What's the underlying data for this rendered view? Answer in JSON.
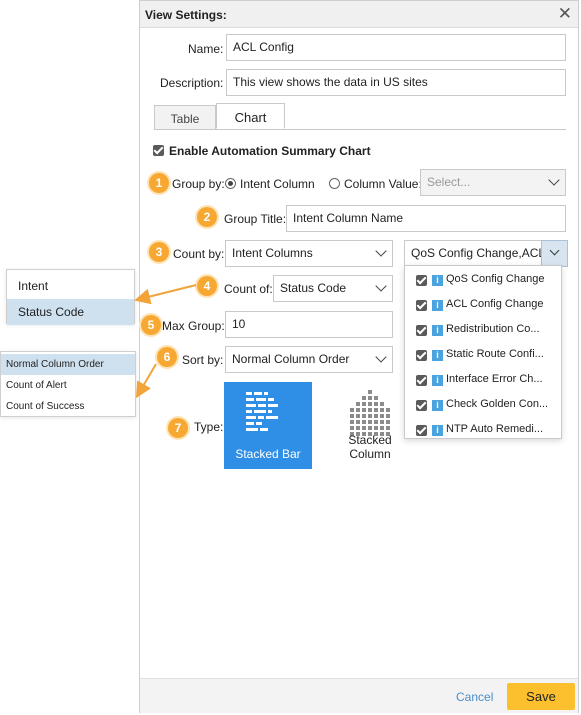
{
  "dialog": {
    "title": "View Settings:",
    "close_glyph": "✕"
  },
  "form": {
    "name_label": "Name:",
    "name_value": "ACL Config",
    "description_label": "Description:",
    "description_value": "This view shows the data in US sites"
  },
  "tabs": [
    {
      "label": "Table",
      "active": false
    },
    {
      "label": "Chart",
      "active": true
    }
  ],
  "chart_settings": {
    "enable_label": "Enable Automation Summary Chart",
    "group_by_label": "Group by:",
    "group_by_options": [
      "Intent Column",
      "Column Value:"
    ],
    "column_value_placeholder": "Select...",
    "group_title_label": "Group Title:",
    "group_title_value": "Intent Column Name",
    "count_by_label": "Count by:",
    "count_by_value": "Intent Columns",
    "count_by_multi_value": "QoS Config Change,ACL...",
    "count_of_label": "Count of:",
    "count_of_value": "Status Code",
    "max_group_label": "Max Group:",
    "max_group_value": "10",
    "sort_by_label": "Sort by:",
    "sort_by_value": "Normal Column Order",
    "type_label": "Type:",
    "types": [
      "Stacked Bar",
      "Stacked Column"
    ]
  },
  "count_by_items": [
    "QoS Config Change",
    "ACL Config Change",
    "Redistribution Co...",
    "Static Route Confi...",
    "Interface Error Ch...",
    "Check Golden Con...",
    "NTP Auto Remedi..."
  ],
  "info_icon_glyph": "i",
  "badges": [
    "1",
    "2",
    "3",
    "4",
    "5",
    "6",
    "7"
  ],
  "count_of_popup": [
    "Intent",
    "Status Code"
  ],
  "sort_by_popup": [
    "Normal Column Order",
    "Count of Alert",
    "Count of Success"
  ],
  "footer": {
    "cancel_label": "Cancel",
    "save_label": "Save"
  },
  "colors": {
    "accent": "#2f8fe6",
    "badge": "#f7a833",
    "save": "#fcc02e",
    "highlight": "#cfe0ee",
    "arrow": "#f2a33a"
  }
}
